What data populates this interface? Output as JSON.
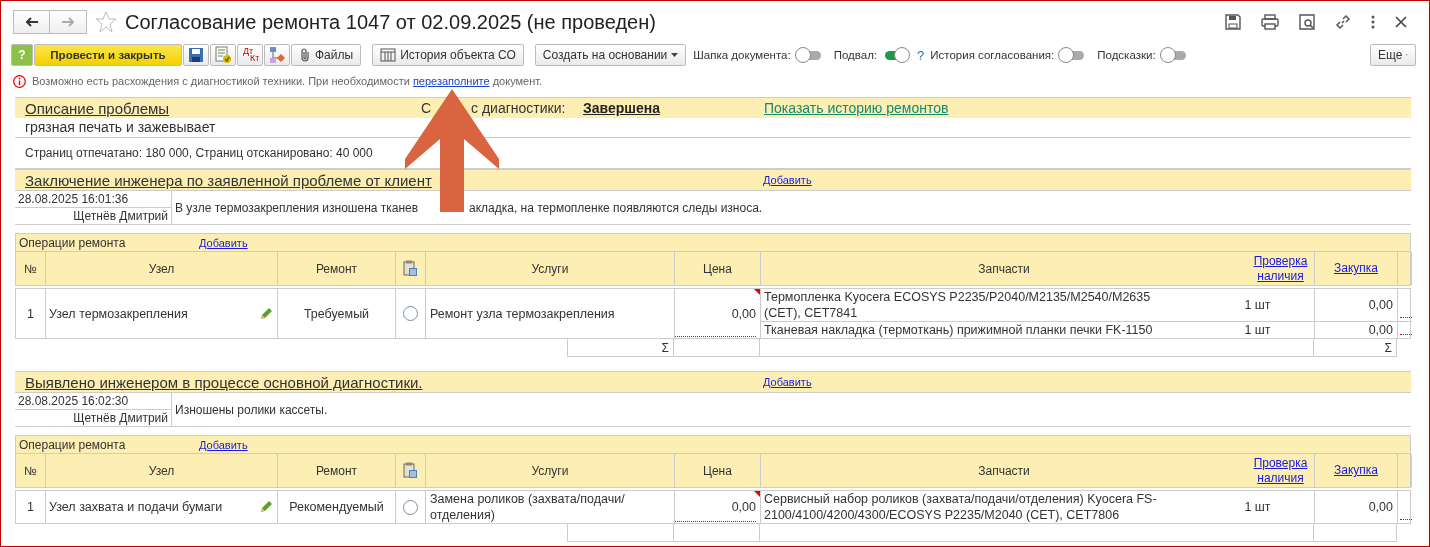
{
  "window": {
    "title": "Согласование ремонта 1047 от 02.09.2025 (не проведен)",
    "favorite": false
  },
  "toolbar": {
    "buttons": [
      {
        "kind": "help",
        "label": "?"
      },
      {
        "kind": "primary",
        "label": "Провести и закрыть"
      },
      {
        "kind": "save"
      },
      {
        "kind": "post"
      },
      {
        "kind": "dtkt",
        "top": "Дт",
        "bottom": "Кт"
      },
      {
        "kind": "structure"
      },
      {
        "kind": "files",
        "label": "Файлы"
      },
      {
        "kind": "history",
        "label": "История объекта СО"
      },
      {
        "kind": "dropdown",
        "label": "Создать на основании"
      }
    ],
    "toggles": [
      {
        "label": "Шапка документа:",
        "on": false
      },
      {
        "label": "Подвал:",
        "on": true,
        "hint": "?"
      },
      {
        "label": "История согласования:",
        "on": false
      },
      {
        "label": "Подсказки:",
        "on": false
      }
    ],
    "more": "Еще"
  },
  "warning": {
    "text": "Возможно есть расхождения с диагностикой техники. При необходимости",
    "link": "перезаполните",
    "tail": "документ."
  },
  "problem": {
    "title": "Описание проблемы",
    "status_label_parts": [
      "С",
      "с диагностики:"
    ],
    "status": "Завершена",
    "history_link": "Показать историю ремонтов",
    "description": "грязная печать и зажевывает",
    "counters": "Страниц отпечатано: 180 000, Страниц отсканировано: 40 000"
  },
  "blocks": [
    {
      "title": "Заключение инженера по заявленной проблеме от клиент",
      "add": "Добавить",
      "date": "28.08.2025 16:01:36",
      "author": "Щетнёв Дмитрий",
      "text_parts": [
        "В узле термозакрепления изношена тканев",
        "акладка, на термопленке появляются следы износа."
      ],
      "operations": {
        "title": "Операции ремонта",
        "add": "Добавить",
        "columns": [
          "№",
          "Узел",
          "Ремонт",
          "Услуги",
          "Цена",
          "Запчасти",
          "Проверка наличия",
          "Закупка"
        ],
        "rows": [
          {
            "num": "1",
            "node": "Узел термозакрепления",
            "repair": "Требуемый",
            "service": "Ремонт узла термозакрепления",
            "service_checked": false,
            "price": "0,00",
            "parts": [
              {
                "name": "Термопленка Kyocera ECOSYS P2235/P2040/M2135/M2540/M2635 (CET), CET7841",
                "qty": "1 шт",
                "price": "0,00"
              },
              {
                "name": "Тканевая накладка (термоткань) прижимной планки печки FK-1150",
                "qty": "1 шт",
                "price": "0,00"
              }
            ]
          }
        ],
        "totals": {
          "price": "Σ",
          "purchase": "Σ"
        }
      }
    },
    {
      "title": "Выявлено инженером в процессе основной диагностики.",
      "add": "Добавить",
      "date": "28.08.2025 16:02:30",
      "author": "Щетнёв Дмитрий",
      "text_parts": [
        "Изношены ролики кассеты."
      ],
      "operations": {
        "title": "Операции ремонта",
        "add": "Добавить",
        "columns": [
          "№",
          "Узел",
          "Ремонт",
          "Услуги",
          "Цена",
          "Запчасти",
          "Проверка наличия",
          "Закупка"
        ],
        "rows": [
          {
            "num": "1",
            "node": "Узел захвата и подачи бумаги",
            "repair": "Рекомендуемый",
            "service": "Замена роликов (захвата/подачи/отделения)",
            "service_checked": false,
            "price": "0,00",
            "parts": [
              {
                "name": "Сервисный набор роликов (захвата/подачи/отделения) Kyocera FS-2100/4100/4200/4300/ECOSYS P2235/M2040 (CET), CET7806",
                "qty": "1 шт",
                "price": "0,00"
              }
            ]
          }
        ]
      }
    }
  ]
}
